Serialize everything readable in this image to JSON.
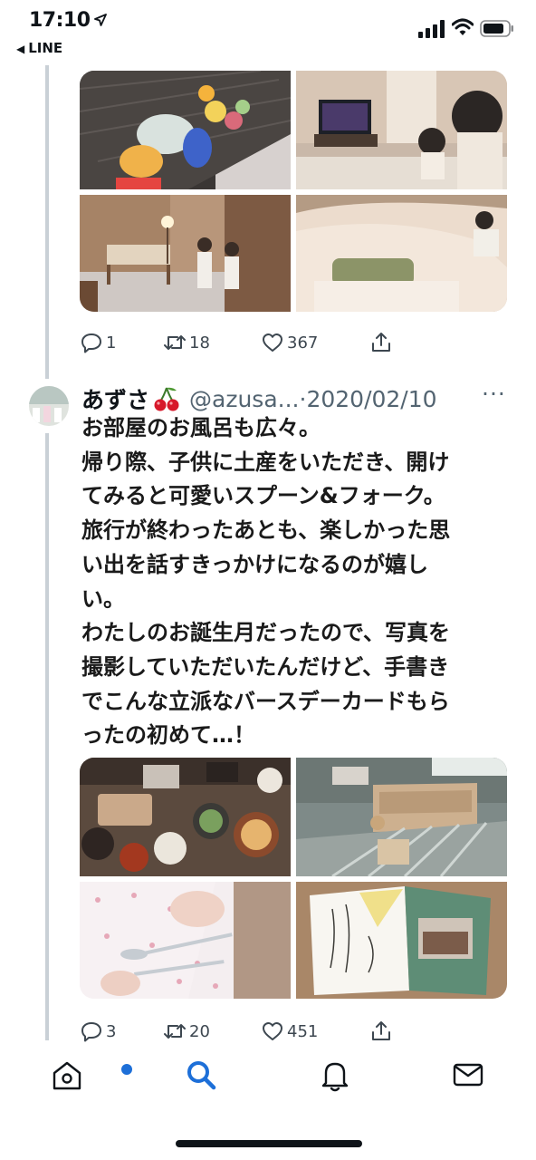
{
  "status_bar": {
    "time": "17:10",
    "back_app": "LINE"
  },
  "tweet_prev": {
    "photos": [
      "toy-basket-photo",
      "tv-room-photo",
      "hallway-kids-photo",
      "futon-bed-photo"
    ],
    "actions": {
      "replies": "1",
      "retweets": "18",
      "likes": "367"
    }
  },
  "tweet": {
    "display_name": "あずさ",
    "handle": "@azusa...",
    "date": "·2020/02/10",
    "more": "···",
    "text_lines": [
      "お部屋のお風呂も広々。",
      "帰り際、子供に土産をいただき、開け",
      "てみると可愛いスプーン&フォーク。",
      "旅行が終わったあとも、楽しかった思",
      "い出を話すきっかけになるのが嬉し",
      "い。",
      "わたしのお誕生月だったので、写真を",
      "撮影していただいたんだけど、手書き",
      "でこんな立派なバースデーカードもら",
      "ったの初めて…！"
    ],
    "photos": [
      "breakfast-photo",
      "wooden-bath-photo",
      "spoon-fork-photo",
      "birthday-card-photo"
    ],
    "actions": {
      "replies": "3",
      "retweets": "20",
      "likes": "451"
    }
  },
  "bottom_nav": {
    "items": [
      "home-icon",
      "search-icon",
      "notifications-icon",
      "messages-icon"
    ],
    "accent": "#1d6fd8"
  },
  "colors": {
    "text": "#0f1419",
    "muted": "#536471",
    "thread": "#c9d0d6"
  }
}
